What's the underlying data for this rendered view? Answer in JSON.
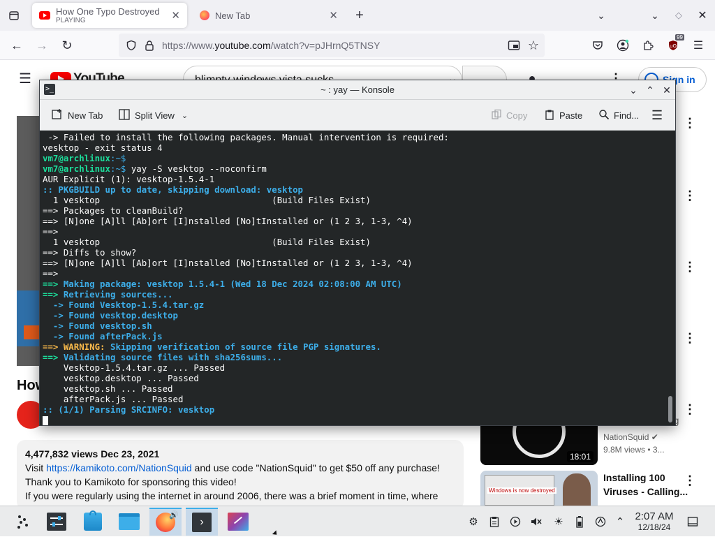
{
  "browser": {
    "tabs": [
      {
        "title": "How One Typo Destroyed",
        "status": "PLAYING"
      },
      {
        "title": "New Tab"
      }
    ],
    "new_tab_symbol": "+",
    "url_prefix": "https://www.",
    "url_domain": "youtube.com",
    "url_path": "/watch?v=pJHrnQ5TNSY",
    "extension_badge": "99"
  },
  "youtube": {
    "logo_text": "YouTube",
    "search_value": "blimpty windows vista sucks",
    "signin_label": "Sign in",
    "title_partial": "How",
    "stats": "4,477,832 views  Dec 23, 2021",
    "desc_prefix": "Visit ",
    "desc_link": "https://kamikoto.com/NationSquid",
    "desc_suffix": " and use code \"NationSquid\" to get $50 off any purchase!",
    "desc_line2": "Thank you to Kamikoto for sponsoring this video!",
    "desc_line3": "If you were regularly using the internet in around 2006, there was a brief moment in time, where",
    "side_fragment": "rg",
    "rec1": {
      "channel": "NationSquid",
      "meta": "9.8M views • 3...",
      "duration": "18:01"
    },
    "rec2": {
      "title_line1": "Installing 100",
      "title_line2": "Viruses - Calling...",
      "thumb_text": "Windows is now destroyed"
    }
  },
  "konsole": {
    "title": "~ : yay — Konsole",
    "toolbar": {
      "new_tab": "New Tab",
      "split_view": "Split View",
      "copy": "Copy",
      "paste": "Paste",
      "find": "Find..."
    },
    "lines": [
      [
        {
          "t": " -> Failed to install the following packages. Manual intervention is required:",
          "c": "w"
        }
      ],
      [
        {
          "t": "vesktop - exit status 4",
          "c": "w"
        }
      ],
      [
        {
          "t": "vm7@archlinux",
          "c": "g"
        },
        {
          "t": ":~$",
          "c": "p"
        }
      ],
      [
        {
          "t": "vm7@archlinux",
          "c": "g"
        },
        {
          "t": ":~$",
          "c": "p"
        },
        {
          "t": " yay -S vesktop --noconfirm",
          "c": "w"
        }
      ],
      [
        {
          "t": "AUR Explicit (1): vesktop-1.5.4-1",
          "c": "w"
        }
      ],
      [
        {
          "t": ":: PKGBUILD up to date, skipping download: vesktop",
          "c": "b"
        }
      ],
      [
        {
          "t": "  1 vesktop                                 (Build Files Exist)",
          "c": "w"
        }
      ],
      [
        {
          "t": "==> Packages to cleanBuild?",
          "c": "w"
        }
      ],
      [
        {
          "t": "==> [N]one [A]ll [Ab]ort [I]nstalled [No]tInstalled or (1 2 3, 1-3, ^4)",
          "c": "w"
        }
      ],
      [
        {
          "t": "==>",
          "c": "w"
        }
      ],
      [
        {
          "t": "  1 vesktop                                 (Build Files Exist)",
          "c": "w"
        }
      ],
      [
        {
          "t": "==> Diffs to show?",
          "c": "w"
        }
      ],
      [
        {
          "t": "==> [N]one [A]ll [Ab]ort [I]nstalled [No]tInstalled or (1 2 3, 1-3, ^4)",
          "c": "w"
        }
      ],
      [
        {
          "t": "==>",
          "c": "w"
        }
      ],
      [
        {
          "t": "==> ",
          "c": "g"
        },
        {
          "t": "Making package: vesktop 1.5.4-1 (Wed 18 Dec 2024 02:08:00 AM UTC)",
          "c": "b"
        }
      ],
      [
        {
          "t": "==> ",
          "c": "g"
        },
        {
          "t": "Retrieving sources...",
          "c": "b"
        }
      ],
      [
        {
          "t": "  -> Found Vesktop-1.5.4.tar.gz",
          "c": "b"
        }
      ],
      [
        {
          "t": "  -> Found vesktop.desktop",
          "c": "b"
        }
      ],
      [
        {
          "t": "  -> Found vesktop.sh",
          "c": "b"
        }
      ],
      [
        {
          "t": "  -> Found afterPack.js",
          "c": "b"
        }
      ],
      [
        {
          "t": "==> WARNING: ",
          "c": "y"
        },
        {
          "t": "Skipping verification of source file PGP signatures.",
          "c": "b"
        }
      ],
      [
        {
          "t": "==> ",
          "c": "g"
        },
        {
          "t": "Validating source files with sha256sums...",
          "c": "b"
        }
      ],
      [
        {
          "t": "    Vesktop-1.5.4.tar.gz ... Passed",
          "c": "w"
        }
      ],
      [
        {
          "t": "    vesktop.desktop ... Passed",
          "c": "w"
        }
      ],
      [
        {
          "t": "    vesktop.sh ... Passed",
          "c": "w"
        }
      ],
      [
        {
          "t": "    afterPack.js ... Passed",
          "c": "w"
        }
      ],
      [
        {
          "t": ":: ",
          "c": "b"
        },
        {
          "t": "(1/1) Parsing SRCINFO: vesktop",
          "c": "b"
        }
      ]
    ]
  },
  "taskbar": {
    "time": "2:07 AM",
    "date": "12/18/24"
  },
  "colors": {
    "terminal_bg": "#232627",
    "prompt_green": "#1cdc9a",
    "info_blue": "#3daee9",
    "warn_yellow": "#fdbc4b",
    "youtube_red": "#ff0000"
  }
}
